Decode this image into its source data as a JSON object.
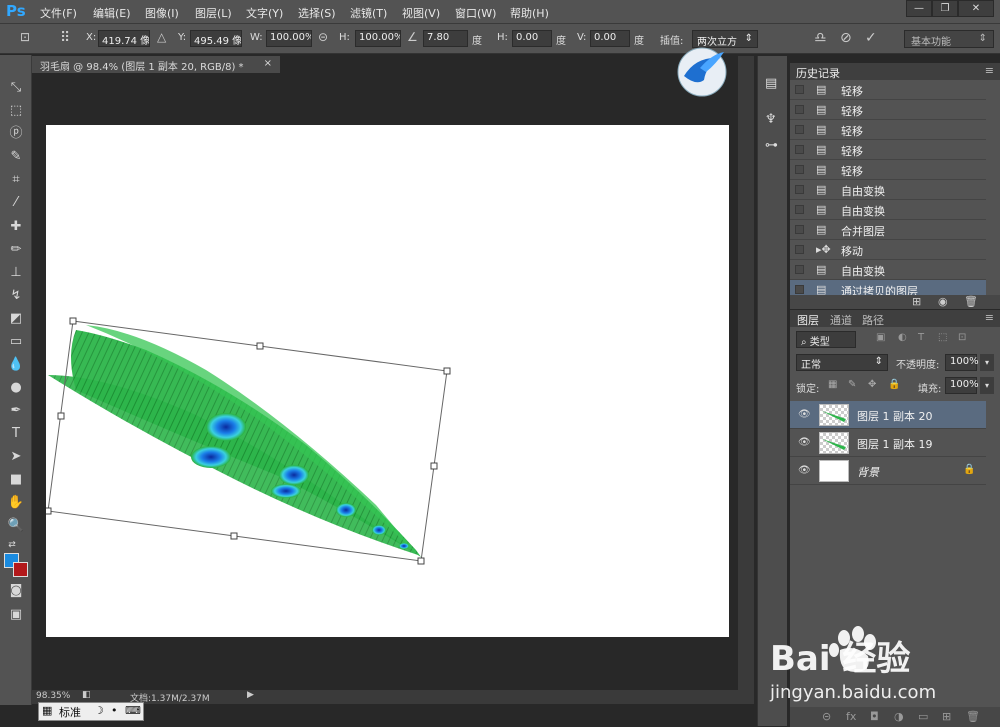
{
  "app": {
    "logo": "Ps"
  },
  "menu": [
    "文件(F)",
    "编辑(E)",
    "图像(I)",
    "图层(L)",
    "文字(Y)",
    "选择(S)",
    "滤镜(T)",
    "视图(V)",
    "窗口(W)",
    "帮助(H)"
  ],
  "window_buttons": {
    "minimize": "—",
    "restore": "❐",
    "close": "✕"
  },
  "options": {
    "x_label": "X:",
    "x_value": "419.74 像素",
    "y_label": "Y:",
    "y_value": "495.49 像素",
    "w_label": "W:",
    "w_value": "100.00%",
    "h_label": "H:",
    "h_value": "100.00%",
    "angle_value": "7.80",
    "angle_unit": "度",
    "hskew_label": "H:",
    "hskew_value": "0.00",
    "hskew_unit": "度",
    "vskew_label": "V:",
    "vskew_value": "0.00",
    "vskew_unit": "度",
    "interp_label": "插值:",
    "interp_value": "两次立方",
    "workspace": "基本功能"
  },
  "document": {
    "tab_title": "羽毛扇 @ 98.4% (图层 1 副本 20, RGB/8) *",
    "tab_close": "×",
    "zoom": "98.35%",
    "doc_info": "文档:1.37M/2.37M"
  },
  "ime": {
    "label": "标准"
  },
  "history": {
    "title": "历史记录",
    "items": [
      {
        "label": "轻移",
        "icon": "document-icon"
      },
      {
        "label": "轻移",
        "icon": "document-icon"
      },
      {
        "label": "轻移",
        "icon": "document-icon"
      },
      {
        "label": "轻移",
        "icon": "document-icon"
      },
      {
        "label": "轻移",
        "icon": "document-icon"
      },
      {
        "label": "自由变换",
        "icon": "document-icon"
      },
      {
        "label": "自由变换",
        "icon": "document-icon"
      },
      {
        "label": "合并图层",
        "icon": "document-icon"
      },
      {
        "label": "移动",
        "icon": "move-icon"
      },
      {
        "label": "自由变换",
        "icon": "document-icon"
      },
      {
        "label": "通过拷贝的图层",
        "icon": "document-icon",
        "selected": true
      }
    ]
  },
  "layers": {
    "tabs": [
      "图层",
      "通道",
      "路径"
    ],
    "filter": "类型",
    "blend_mode": "正常",
    "opacity_label": "不透明度:",
    "opacity_value": "100%",
    "lock_label": "锁定:",
    "fill_label": "填充:",
    "fill_value": "100%",
    "items": [
      {
        "name": "图层 1 副本 20",
        "selected": true
      },
      {
        "name": "图层 1 副本 19",
        "selected": false
      },
      {
        "name": "背景",
        "selected": false,
        "locked": true
      }
    ]
  },
  "watermark": {
    "brand": "Bai 经验",
    "url": "jingyan.baidu.com"
  }
}
